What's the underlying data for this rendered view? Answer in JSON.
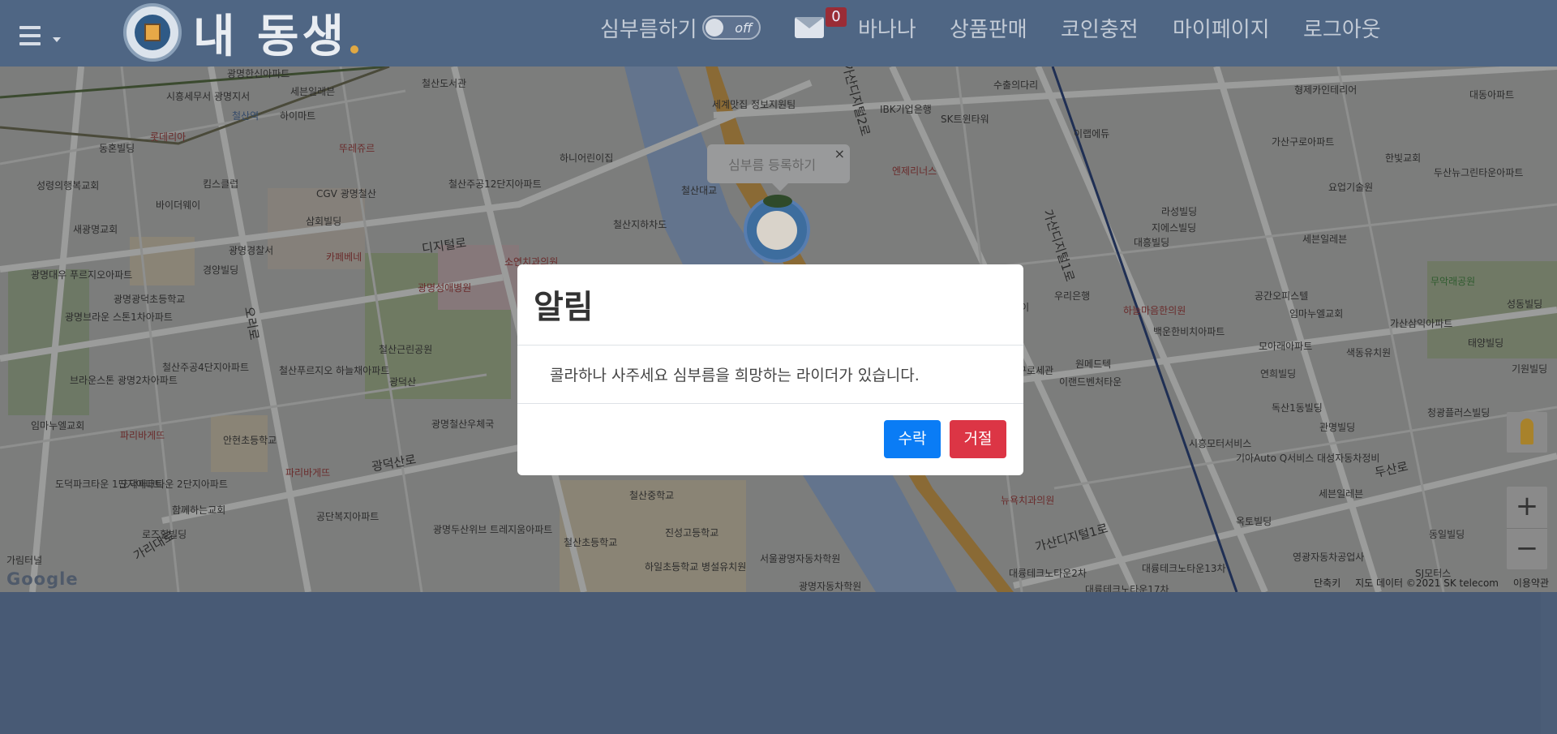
{
  "header": {
    "logo_text": "내 동생",
    "errand_toggle_label": "심부름하기",
    "toggle_state": "off",
    "message_count": "0",
    "nav": [
      "바나나",
      "상품판매",
      "코인충전",
      "마이페이지",
      "로그아웃"
    ]
  },
  "map": {
    "tooltip_text": "심부름 등록하기",
    "tooltip_close": "×",
    "zoom_in": "+",
    "zoom_out": "−",
    "google_logo": "Google",
    "attribution": [
      "단축키",
      "지도 데이터 ©2021 SK telecom",
      "이용약관"
    ],
    "road_labels": [
      "디지털로",
      "광덕산로",
      "오리로",
      "가산디지털1로",
      "가산디지털1로",
      "가산디지털2로",
      "두산로",
      "가리대로"
    ],
    "place_labels": [
      "광명한신아파트",
      "시흥세무서 광명지서",
      "세븐일레븐",
      "철산도서관",
      "철산역",
      "하이마트",
      "뚜레쥬르",
      "롯데리아",
      "동혼빌딩",
      "성령의행복교회",
      "킴스클럽",
      "CGV 광명철산",
      "하니어린이집",
      "철산주공12단지아파트",
      "철산대교",
      "세계맛집 정보지원팀",
      "IBK기업은행",
      "SK트윈타워",
      "엔제리너스",
      "수출의다리",
      "이랩에듀",
      "형제카인테리어",
      "대동아파트",
      "가산구로아파트",
      "한빛교회",
      "두산뉴그린타운아파트",
      "요업기술원",
      "바이더웨이",
      "새광명교회",
      "삼회빌딩",
      "철산지하차도",
      "라성빌딩",
      "지에스빌딩",
      "대흥빌딩",
      "세븐일레븐",
      "광명경찰서",
      "카페베네",
      "경양빌딩",
      "광명성애병원",
      "소연치과의원",
      "광명대우 푸르지오아파트",
      "광명광덕초등학교",
      "광명브라운 스톤1차아파트",
      "철산근린공원",
      "광덕산",
      "철산주공4단지아파트",
      "철산푸르지오 하늘채아파트",
      "브라운스톤 광명2차아파트",
      "임마누엘교회",
      "파리바게뜨",
      "안현초등학교",
      "광명철산우체국",
      "파리바게뜨",
      "도덕파크타운 1단지아파트",
      "도덕파크타운 2단지아파트",
      "함께하는교회",
      "공단복지아파트",
      "로즈힐빌딩",
      "광명두산위브 트레지움아파트",
      "철산초등학교",
      "철산중학교",
      "진성고등학교",
      "하일초등학교 병설유치원",
      "서울광명자동차학원",
      "광명자동차학원",
      "가림터널",
      "이디에이",
      "우리은행",
      "하늘마음한의원",
      "공간오피스텔",
      "임마누엘교회",
      "가산삼익아파트",
      "무악래공원",
      "성동빌딩",
      "백운한비치아파트",
      "모아래아파트",
      "태양빌딩",
      "원메드텍",
      "이랜드벤처타운",
      "구로세관",
      "색동유치원",
      "연희빌딩",
      "기원빌딩",
      "독산1동빌딩",
      "관명빌딩",
      "청광플러스빌딩",
      "시흥모터서비스",
      "기아Auto Q서비스 대성자동차정비",
      "세븐일레븐",
      "옥토빌딩",
      "동일빌딩",
      "영광자동차공업사",
      "SJ모터스",
      "대륭테크노타운2차",
      "대륭테크노타운13차",
      "대륭테크노타운17차",
      "뉴욕치과의원"
    ]
  },
  "modal": {
    "title": "알림",
    "message": "콜라하나 사주세요 심부름을 희망하는 라이더가 있습니다.",
    "accept_label": "수락",
    "reject_label": "거절"
  },
  "colors": {
    "header_bg": "#4f6684",
    "accept": "#0a7cf5",
    "reject": "#dc3545",
    "footer_bg": "#485a75"
  }
}
